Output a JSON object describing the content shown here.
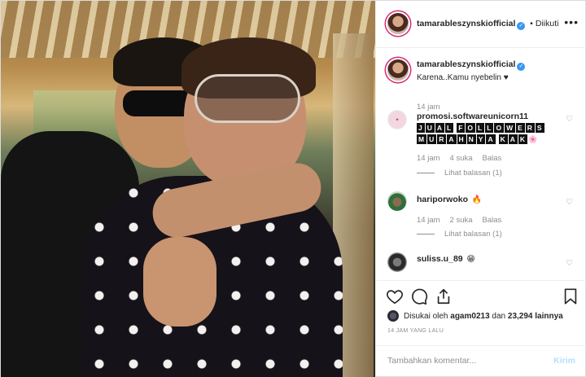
{
  "header": {
    "username": "tamarableszynskiofficial",
    "follow_separator": "•",
    "follow_label": "Diikuti",
    "more_label": "•••"
  },
  "caption": {
    "username": "tamarableszynskiofficial",
    "text": "Karena..Kamu nyebelin ♥",
    "time": "14 jam"
  },
  "comments": [
    {
      "username": "promosi.softwareunicorn11",
      "text_line1": [
        "J",
        "U",
        "A",
        "L",
        "F",
        "O",
        "L",
        "L",
        "O",
        "W",
        "E",
        "R",
        "S"
      ],
      "text_line2": [
        "M",
        "U",
        "R",
        "A",
        "H",
        "N",
        "Y",
        "A",
        "K",
        "A",
        "K"
      ],
      "emoji": "🌸",
      "time": "14 jam",
      "likes": "4 suka",
      "reply": "Balas",
      "view_replies": "Lihat balasan (1)"
    },
    {
      "username": "hariporwoko",
      "emoji": "🔥",
      "time": "14 jam",
      "likes": "2 suka",
      "reply": "Balas",
      "view_replies": "Lihat balasan (1)"
    },
    {
      "username": "suliss.u_89",
      "emoji": "😁",
      "time": "",
      "likes": "",
      "reply": ""
    }
  ],
  "actions": {
    "liked_by_prefix": "Disukai oleh",
    "liked_by_user": "agam0213",
    "liked_by_and": "dan",
    "liked_by_count": "23,294 lainnya",
    "time_ago": "14 JAM YANG LALU"
  },
  "add_comment": {
    "placeholder": "Tambahkan komentar...",
    "post_label": "Kirim"
  },
  "colors": {
    "accent": "#3897f0",
    "post_disabled": "#b2dffc",
    "muted": "#8e8e8e"
  }
}
